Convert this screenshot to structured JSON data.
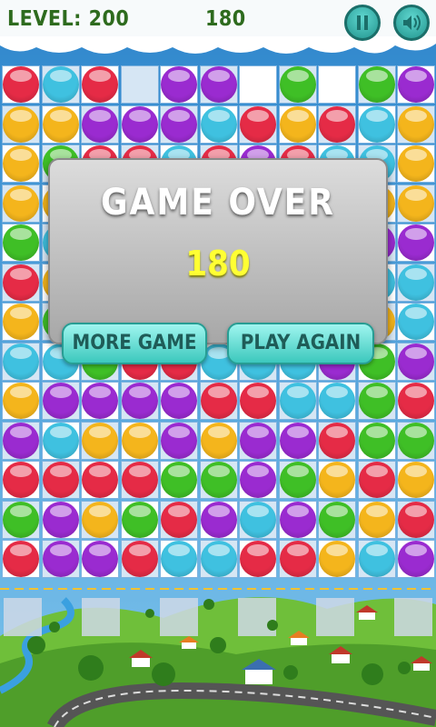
{
  "hud": {
    "level_text": "LEVEL: 200",
    "score_text": "180"
  },
  "controls": {
    "pause_icon": "pause-icon",
    "sound_icon": "speaker-icon"
  },
  "dialog": {
    "title": "GAME OVER",
    "score": "180",
    "more_game_label": "MORE GAME",
    "play_again_label": "PLAY AGAIN"
  },
  "colors": {
    "red": "#e52b46",
    "blue": "#3fc1e0",
    "purple": "#9a2bd0",
    "yellow": "#f4b51c",
    "green": "#3fbf26",
    "sky": "#2b7fc4",
    "grass": "#6fbf3a"
  },
  "board": {
    "rows": [
      "RBR.PP.G.GP",
      "YYPPPBRYRBY",
      "YGRRBRPRBBY",
      "YYYYGRPBPYY",
      "GBRYYRYBBPP",
      "RYBPGGYRYBB",
      "YGPRRYGBYYB",
      "BBGRRBBBPGP",
      "YPPPPRRBBGR",
      "PBYYPYPPRGG",
      "RRRRGGPGYRY",
      "GPYGRPBPGYR",
      "RPPRBBRRYBP"
    ]
  }
}
